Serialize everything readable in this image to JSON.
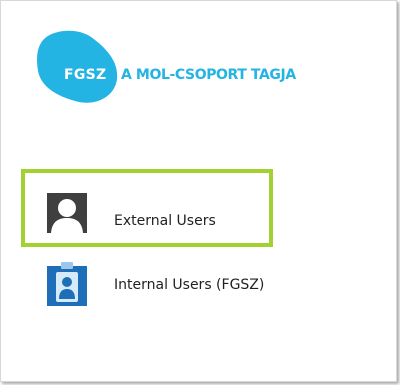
{
  "logo": {
    "badge_text": "FGSZ",
    "tagline": "A MOL-CSOPORT TAGJA",
    "brand_color": "#24b4e3"
  },
  "options": [
    {
      "label": "External Users",
      "icon": "user-silhouette-icon",
      "selected": true
    },
    {
      "label": "Internal Users (FGSZ)",
      "icon": "id-badge-icon",
      "selected": false
    }
  ],
  "colors": {
    "selection_border": "#a3d132",
    "external_icon_bg": "#3f3f3f",
    "internal_icon_bg": "#1e6fb8"
  }
}
